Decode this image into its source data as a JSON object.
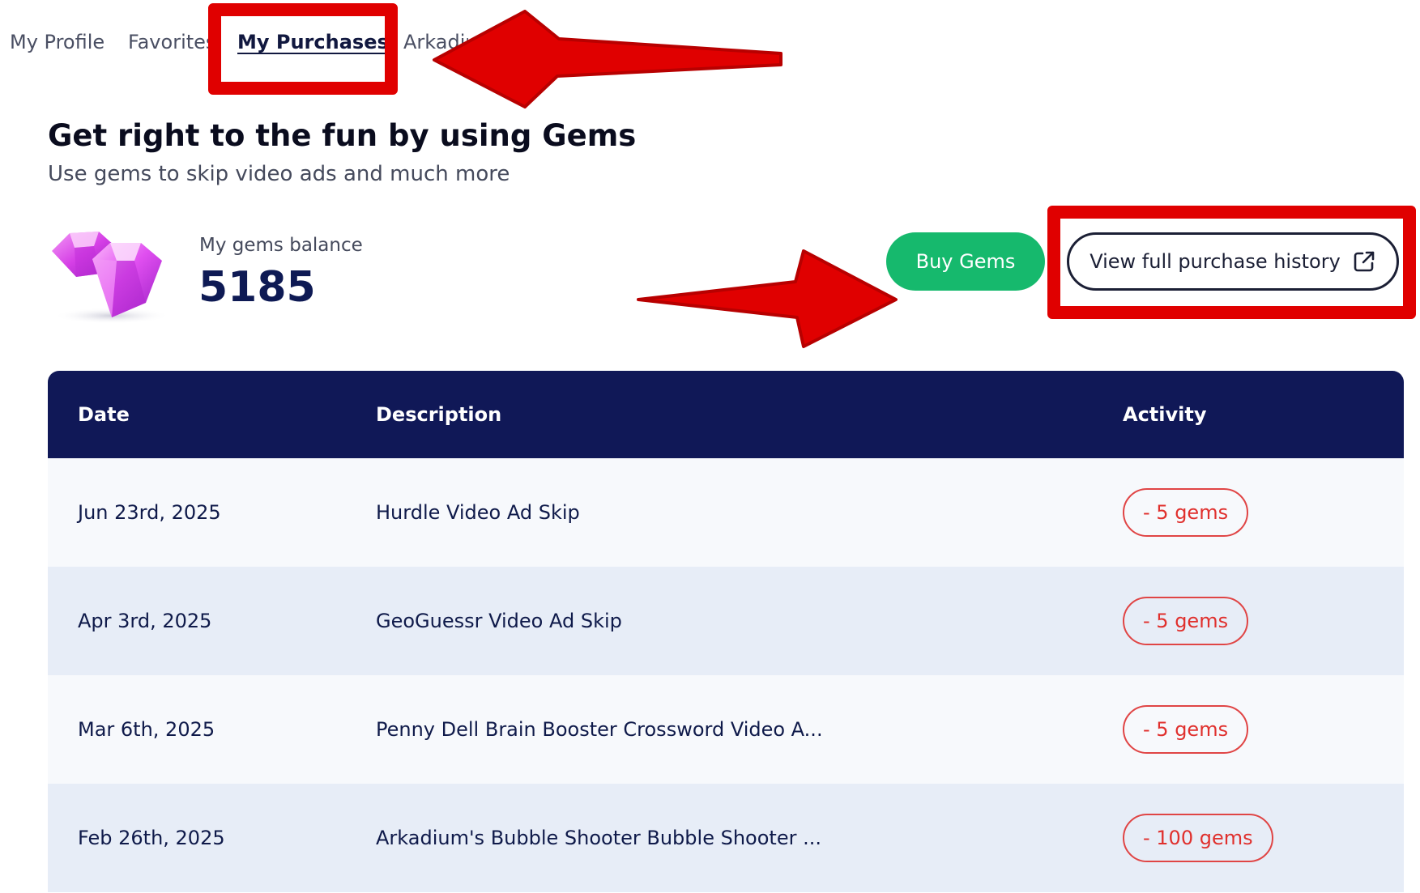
{
  "nav": {
    "tabs": [
      {
        "label": "My Profile"
      },
      {
        "label": "Favorites"
      },
      {
        "label": "My Purchases",
        "active": true
      },
      {
        "label": "Arkadium"
      }
    ]
  },
  "hero": {
    "title": "Get right to the fun by using Gems",
    "subtitle": "Use gems to skip video ads and much more"
  },
  "balance": {
    "label": "My gems balance",
    "value": "5185",
    "icon": "gems-icon"
  },
  "buttons": {
    "buy": "Buy Gems",
    "history": "View full purchase history",
    "history_icon": "external-link-icon"
  },
  "table": {
    "headers": [
      "Date",
      "Description",
      "Activity"
    ],
    "rows": [
      {
        "date": "Jun 23rd, 2025",
        "description": "Hurdle Video Ad Skip",
        "activity": "- 5 gems"
      },
      {
        "date": "Apr 3rd, 2025",
        "description": "GeoGuessr Video Ad Skip",
        "activity": "- 5 gems"
      },
      {
        "date": "Mar 6th, 2025",
        "description": "Penny Dell Brain Booster Crossword Video A...",
        "activity": "- 5 gems"
      },
      {
        "date": "Feb 26th, 2025",
        "description": "Arkadium's Bubble Shooter Bubble Shooter ...",
        "activity": "- 100 gems"
      }
    ]
  },
  "colors": {
    "accent_green": "#16b96d",
    "header_navy": "#101857",
    "activity_red": "#e0302d",
    "annotation_red": "#e00000"
  }
}
